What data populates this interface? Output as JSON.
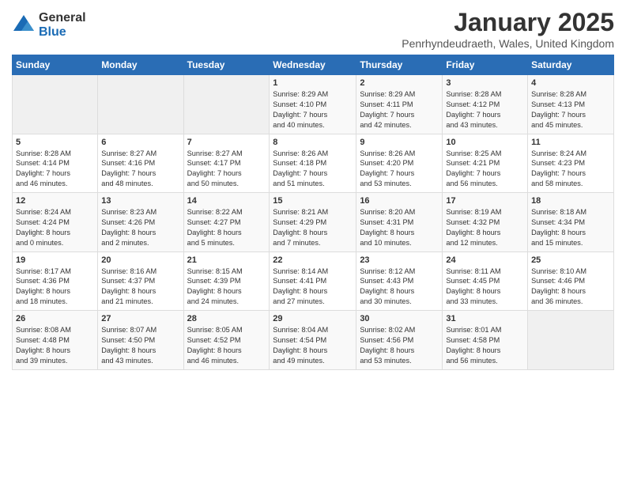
{
  "logo": {
    "general": "General",
    "blue": "Blue"
  },
  "header": {
    "title": "January 2025",
    "subtitle": "Penrhyndeudraeth, Wales, United Kingdom"
  },
  "weekdays": [
    "Sunday",
    "Monday",
    "Tuesday",
    "Wednesday",
    "Thursday",
    "Friday",
    "Saturday"
  ],
  "weeks": [
    [
      {
        "day": "",
        "info": ""
      },
      {
        "day": "",
        "info": ""
      },
      {
        "day": "",
        "info": ""
      },
      {
        "day": "1",
        "info": "Sunrise: 8:29 AM\nSunset: 4:10 PM\nDaylight: 7 hours\nand 40 minutes."
      },
      {
        "day": "2",
        "info": "Sunrise: 8:29 AM\nSunset: 4:11 PM\nDaylight: 7 hours\nand 42 minutes."
      },
      {
        "day": "3",
        "info": "Sunrise: 8:28 AM\nSunset: 4:12 PM\nDaylight: 7 hours\nand 43 minutes."
      },
      {
        "day": "4",
        "info": "Sunrise: 8:28 AM\nSunset: 4:13 PM\nDaylight: 7 hours\nand 45 minutes."
      }
    ],
    [
      {
        "day": "5",
        "info": "Sunrise: 8:28 AM\nSunset: 4:14 PM\nDaylight: 7 hours\nand 46 minutes."
      },
      {
        "day": "6",
        "info": "Sunrise: 8:27 AM\nSunset: 4:16 PM\nDaylight: 7 hours\nand 48 minutes."
      },
      {
        "day": "7",
        "info": "Sunrise: 8:27 AM\nSunset: 4:17 PM\nDaylight: 7 hours\nand 50 minutes."
      },
      {
        "day": "8",
        "info": "Sunrise: 8:26 AM\nSunset: 4:18 PM\nDaylight: 7 hours\nand 51 minutes."
      },
      {
        "day": "9",
        "info": "Sunrise: 8:26 AM\nSunset: 4:20 PM\nDaylight: 7 hours\nand 53 minutes."
      },
      {
        "day": "10",
        "info": "Sunrise: 8:25 AM\nSunset: 4:21 PM\nDaylight: 7 hours\nand 56 minutes."
      },
      {
        "day": "11",
        "info": "Sunrise: 8:24 AM\nSunset: 4:23 PM\nDaylight: 7 hours\nand 58 minutes."
      }
    ],
    [
      {
        "day": "12",
        "info": "Sunrise: 8:24 AM\nSunset: 4:24 PM\nDaylight: 8 hours\nand 0 minutes."
      },
      {
        "day": "13",
        "info": "Sunrise: 8:23 AM\nSunset: 4:26 PM\nDaylight: 8 hours\nand 2 minutes."
      },
      {
        "day": "14",
        "info": "Sunrise: 8:22 AM\nSunset: 4:27 PM\nDaylight: 8 hours\nand 5 minutes."
      },
      {
        "day": "15",
        "info": "Sunrise: 8:21 AM\nSunset: 4:29 PM\nDaylight: 8 hours\nand 7 minutes."
      },
      {
        "day": "16",
        "info": "Sunrise: 8:20 AM\nSunset: 4:31 PM\nDaylight: 8 hours\nand 10 minutes."
      },
      {
        "day": "17",
        "info": "Sunrise: 8:19 AM\nSunset: 4:32 PM\nDaylight: 8 hours\nand 12 minutes."
      },
      {
        "day": "18",
        "info": "Sunrise: 8:18 AM\nSunset: 4:34 PM\nDaylight: 8 hours\nand 15 minutes."
      }
    ],
    [
      {
        "day": "19",
        "info": "Sunrise: 8:17 AM\nSunset: 4:36 PM\nDaylight: 8 hours\nand 18 minutes."
      },
      {
        "day": "20",
        "info": "Sunrise: 8:16 AM\nSunset: 4:37 PM\nDaylight: 8 hours\nand 21 minutes."
      },
      {
        "day": "21",
        "info": "Sunrise: 8:15 AM\nSunset: 4:39 PM\nDaylight: 8 hours\nand 24 minutes."
      },
      {
        "day": "22",
        "info": "Sunrise: 8:14 AM\nSunset: 4:41 PM\nDaylight: 8 hours\nand 27 minutes."
      },
      {
        "day": "23",
        "info": "Sunrise: 8:12 AM\nSunset: 4:43 PM\nDaylight: 8 hours\nand 30 minutes."
      },
      {
        "day": "24",
        "info": "Sunrise: 8:11 AM\nSunset: 4:45 PM\nDaylight: 8 hours\nand 33 minutes."
      },
      {
        "day": "25",
        "info": "Sunrise: 8:10 AM\nSunset: 4:46 PM\nDaylight: 8 hours\nand 36 minutes."
      }
    ],
    [
      {
        "day": "26",
        "info": "Sunrise: 8:08 AM\nSunset: 4:48 PM\nDaylight: 8 hours\nand 39 minutes."
      },
      {
        "day": "27",
        "info": "Sunrise: 8:07 AM\nSunset: 4:50 PM\nDaylight: 8 hours\nand 43 minutes."
      },
      {
        "day": "28",
        "info": "Sunrise: 8:05 AM\nSunset: 4:52 PM\nDaylight: 8 hours\nand 46 minutes."
      },
      {
        "day": "29",
        "info": "Sunrise: 8:04 AM\nSunset: 4:54 PM\nDaylight: 8 hours\nand 49 minutes."
      },
      {
        "day": "30",
        "info": "Sunrise: 8:02 AM\nSunset: 4:56 PM\nDaylight: 8 hours\nand 53 minutes."
      },
      {
        "day": "31",
        "info": "Sunrise: 8:01 AM\nSunset: 4:58 PM\nDaylight: 8 hours\nand 56 minutes."
      },
      {
        "day": "",
        "info": ""
      }
    ]
  ]
}
